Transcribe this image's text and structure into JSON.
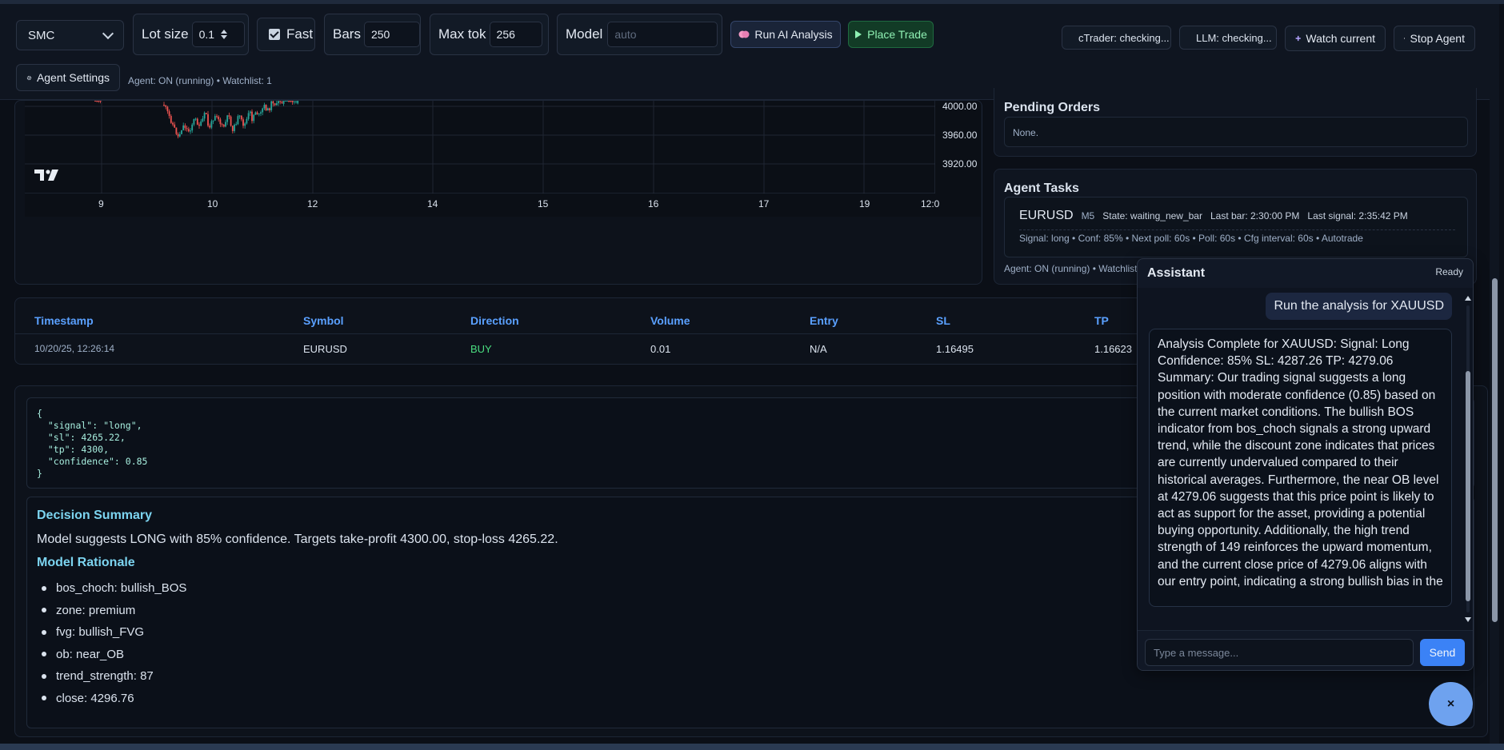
{
  "toolbar": {
    "strategy_value": "SMC",
    "lot_label": "Lot size",
    "lot_value": "0.1",
    "fast_label": "Fast",
    "bars_label": "Bars",
    "bars_value": "250",
    "maxtok_label": "Max tok",
    "maxtok_value": "256",
    "model_label": "Model",
    "model_placeholder": "auto",
    "run_ai_label": "Run AI Analysis",
    "place_trade_label": "Place Trade",
    "ctrader_status": "cTrader: checking...",
    "llm_status": "LLM: checking...",
    "watch_label": "Watch current",
    "stop_label": "Stop Agent",
    "agent_settings_label": "Agent Settings",
    "agent_status": "Agent: ON (running) • Watchlist: 1"
  },
  "chart": {
    "price_labels": [
      "4000.00",
      "3960.00",
      "3920.00"
    ],
    "time_labels": [
      "9",
      "10",
      "12",
      "14",
      "15",
      "16",
      "17",
      "19",
      "12:0"
    ],
    "logo": "TV"
  },
  "pending_orders": {
    "title": "Pending Orders",
    "content": "None."
  },
  "agent_tasks": {
    "title": "Agent Tasks",
    "symbol": "EURUSD",
    "timeframe": "M5",
    "state": "State: waiting_new_bar",
    "last_bar": "Last bar: 2:30:00 PM",
    "last_signal": "Last signal: 2:35:42 PM",
    "details": "Signal: long • Conf: 85% • Next poll: 60s • Poll: 60s • Cfg interval: 60s • Autotrade",
    "footer": "Agent: ON (running) • Watchlist"
  },
  "trades": {
    "headers": [
      "Timestamp",
      "Symbol",
      "Direction",
      "Volume",
      "Entry",
      "SL",
      "TP"
    ],
    "row": [
      "10/20/25, 12:26:14",
      "EURUSD",
      "BUY",
      "0.01",
      "N/A",
      "1.16495",
      "1.16623"
    ],
    "buy_color": "#4ade80"
  },
  "analysis": {
    "json_text": "{\n  \"signal\": \"long\",\n  \"sl\": 4265.22,\n  \"tp\": 4300,\n  \"confidence\": 0.85\n}",
    "decision_title": "Decision Summary",
    "decision_text": "Model suggests LONG with 85% confidence. Targets take-profit 4300.00, stop-loss 4265.22.",
    "rationale_title": "Model Rationale",
    "rationale": [
      "bos_choch: bullish_BOS",
      "zone: premium",
      "fvg: bullish_FVG",
      "ob: near_OB",
      "trend_strength: 87",
      "close: 4296.76"
    ]
  },
  "assistant": {
    "title": "Assistant",
    "status": "Ready",
    "user_message": "Run the analysis for XAUUSD",
    "bot_message": "Analysis Complete for XAUUSD: Signal: Long Confidence: 85% SL: 4287.26 TP: 4279.06 Summary: Our trading signal suggests a long position with moderate confidence (0.85) based on the current market conditions. The bullish BOS indicator from bos_choch signals a strong upward trend, while the discount zone indicates that prices are currently undervalued compared to their historical averages. Furthermore, the near OB level at 4279.06 suggests that this price point is likely to act as support for the asset, providing a potential buying opportunity. Additionally, the high trend strength of 149 reinforces the upward momentum, and the current close price of 4279.06 aligns with our entry point, indicating a strong bullish bias in the",
    "input_placeholder": "Type a message...",
    "send_label": "Send",
    "close_label": "×"
  },
  "icons": {
    "ai": "brain-icon",
    "trade": "play-icon",
    "watch": "plus-icon",
    "stop": "stop-icon",
    "settings": "gear-icon"
  },
  "colors": {
    "accent": "#5aa0ff",
    "buy": "#4ade80",
    "send": "#3b82f6"
  }
}
